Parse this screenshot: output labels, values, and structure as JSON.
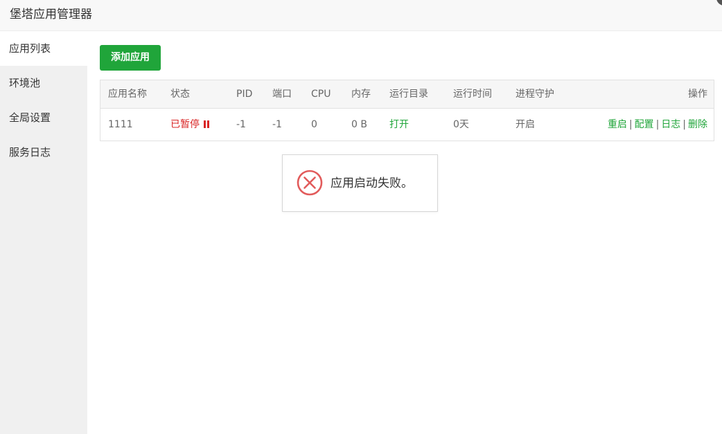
{
  "window": {
    "title": "堡塔应用管理器"
  },
  "sidebar": {
    "items": [
      {
        "label": "应用列表",
        "active": true
      },
      {
        "label": "环境池",
        "active": false
      },
      {
        "label": "全局设置",
        "active": false
      },
      {
        "label": "服务日志",
        "active": false
      }
    ]
  },
  "toolbar": {
    "add_label": "添加应用"
  },
  "table": {
    "headers": {
      "name": "应用名称",
      "status": "状态",
      "pid": "PID",
      "port": "端口",
      "cpu": "CPU",
      "memory": "内存",
      "dir": "运行目录",
      "uptime": "运行时间",
      "guard": "进程守护",
      "ops": "操作"
    },
    "rows": [
      {
        "name": "1111",
        "status": "已暂停",
        "pid": "-1",
        "port": "-1",
        "cpu": "0",
        "memory": "0 B",
        "dir": "打开",
        "uptime": "0天",
        "guard": "开启",
        "ops": {
          "restart": "重启",
          "config": "配置",
          "log": "日志",
          "delete": "删除"
        }
      }
    ]
  },
  "toast": {
    "message": "应用启动失败。",
    "icon": "error-circle-icon"
  },
  "colors": {
    "accent": "#20a53a",
    "danger": "#d92525",
    "sidebar_bg": "#f0f0f0",
    "header_bg": "#f6f6f6"
  }
}
